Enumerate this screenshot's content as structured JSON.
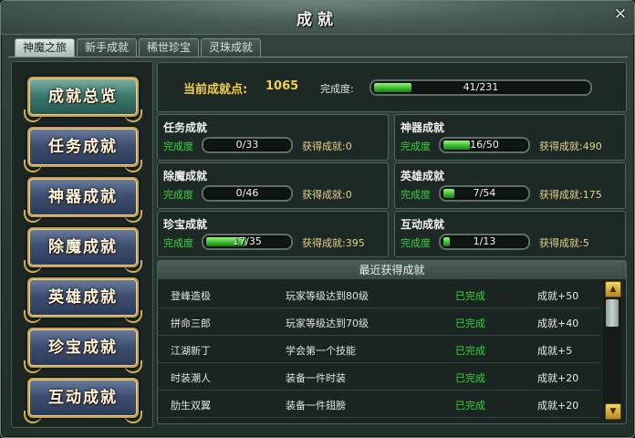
{
  "window": {
    "title": "成就",
    "close_icon": "×"
  },
  "tabs": [
    {
      "label": "神魔之旅"
    },
    {
      "label": "新手成就"
    },
    {
      "label": "稀世珍宝"
    },
    {
      "label": "灵珠成就"
    }
  ],
  "categories": [
    {
      "label": "成就总览"
    },
    {
      "label": "任务成就"
    },
    {
      "label": "神器成就"
    },
    {
      "label": "除魔成就"
    },
    {
      "label": "英雄成就"
    },
    {
      "label": "珍宝成就"
    },
    {
      "label": "互动成就"
    }
  ],
  "summary": {
    "points_label": "当前成就点:",
    "points_value": "1065",
    "progress_label": "完成度:",
    "progress_text": "41/231",
    "progress": 0.177
  },
  "cards": [
    {
      "name": "任务成就",
      "progress_label": "完成度",
      "progress_text": "0/33",
      "progress": 0.0,
      "earned": "获得成就:0"
    },
    {
      "name": "神器成就",
      "progress_label": "完成度",
      "progress_text": "16/50",
      "progress": 0.32,
      "earned": "获得成就:490"
    },
    {
      "name": "除魔成就",
      "progress_label": "完成度",
      "progress_text": "0/46",
      "progress": 0.0,
      "earned": "获得成就:0"
    },
    {
      "name": "英雄成就",
      "progress_label": "完成度",
      "progress_text": "7/54",
      "progress": 0.13,
      "earned": "获得成就:175"
    },
    {
      "name": "珍宝成就",
      "progress_label": "完成度",
      "progress_text": "17/35",
      "progress": 0.486,
      "earned": "获得成就:395"
    },
    {
      "name": "互动成就",
      "progress_label": "完成度",
      "progress_text": "1/13",
      "progress": 0.077,
      "earned": "获得成就:5"
    }
  ],
  "recent": {
    "title": "最近获得成就",
    "rows": [
      {
        "name": "登峰造极",
        "desc": "玩家等级达到80级",
        "status": "已完成",
        "reward": "成就+50"
      },
      {
        "name": "拼命三郎",
        "desc": "玩家等级达到70级",
        "status": "已完成",
        "reward": "成就+40"
      },
      {
        "name": "江湖新丁",
        "desc": "学会第一个技能",
        "status": "已完成",
        "reward": "成就+5"
      },
      {
        "name": "时装潮人",
        "desc": "装备一件时装",
        "status": "已完成",
        "reward": "成就+20"
      },
      {
        "name": "肋生双翼",
        "desc": "装备一件翅膀",
        "status": "已完成",
        "reward": "成就+20"
      }
    ]
  },
  "colors": {
    "accent_gold": "#f2cf52",
    "complete_green": "#34d634",
    "bar_green": "#35b72e"
  }
}
